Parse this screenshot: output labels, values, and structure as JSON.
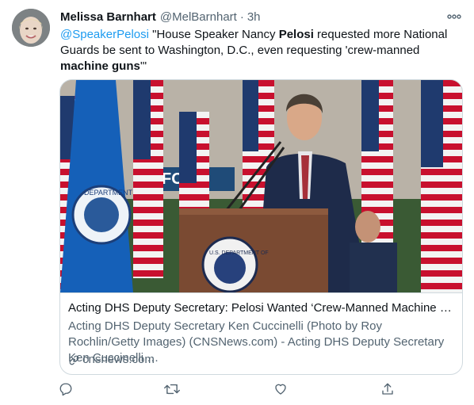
{
  "tweet": {
    "author_name": "Melissa Barnhart",
    "author_handle": "@MelBarnhart",
    "separator": "·",
    "time": "3h",
    "mention": "@SpeakerPelosi",
    "text_1": " \"House Speaker Nancy ",
    "bold_1": "Pelosi",
    "text_2": " requested more National Guards be sent to Washington, D.C., even requesting 'crew-manned ",
    "bold_2": "machine guns",
    "text_3": "'\""
  },
  "card": {
    "title": "Acting DHS Deputy Secretary: Pelosi Wanted ‘Crew-Manned Machine Gu…",
    "description": "Acting DHS Deputy Secretary Ken Cuccinelli (Photo by Roy Rochlin/Getty Images) (CNSNews.com) - Acting DHS Deputy Secretary Ken Cuccinelli …",
    "domain": "cnsnews.com",
    "image_sign_text": "FOX",
    "seal_text": "U.S. DEPARTMENT OF",
    "flag_seal_text": "DEPARTMENT"
  },
  "colors": {
    "link_blue": "#1d9bf0",
    "secondary_text": "#536471",
    "border": "#cfd9de"
  },
  "icons": {
    "more": "more-horizontal-icon",
    "reply": "reply-icon",
    "retweet": "retweet-icon",
    "like": "heart-icon",
    "share": "share-icon",
    "link": "link-icon"
  }
}
